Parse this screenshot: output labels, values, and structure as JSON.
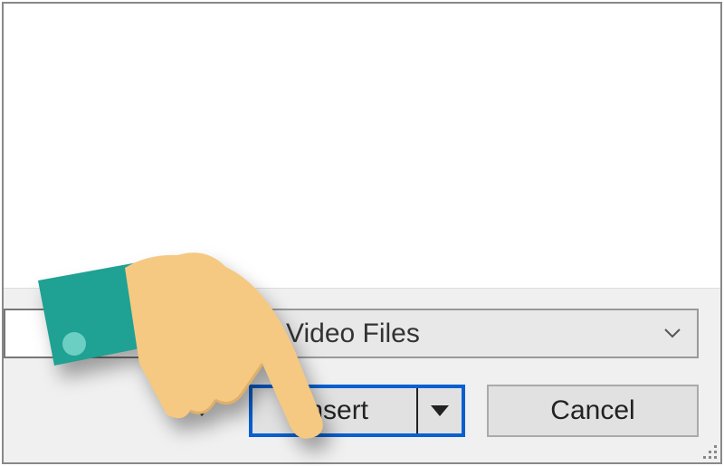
{
  "dialog": {
    "filter": {
      "selected": "Video Files"
    },
    "buttons": {
      "insert": "Insert",
      "cancel": "Cancel"
    }
  },
  "colors": {
    "highlight": "#0a5fd0",
    "hand_skin": "#f5c981",
    "hand_cuff": "#1fa193",
    "hand_button": "#6ccfc3"
  }
}
